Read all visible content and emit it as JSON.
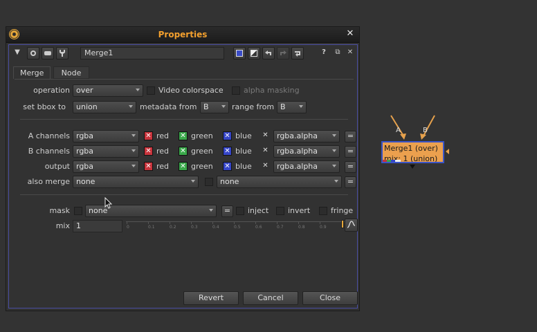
{
  "window": {
    "title": "Properties",
    "close_glyph": "✕",
    "app_icon": "nuke-icon"
  },
  "toolbar": {
    "collapse_glyph": "▼",
    "node_name": "Merge1",
    "help_glyph": "?",
    "float_glyph": "⧉",
    "close_glyph": "✕"
  },
  "tabs": [
    {
      "label": "Merge",
      "active": true
    },
    {
      "label": "Node",
      "active": false
    }
  ],
  "merge": {
    "operation_label": "operation",
    "operation_value": "over",
    "video_colorspace_label": "Video colorspace",
    "alpha_masking_label": "alpha masking",
    "bbox_label": "set bbox to",
    "bbox_value": "union",
    "metadata_label": "metadata from",
    "metadata_value": "B",
    "range_label": "range from",
    "range_value": "B",
    "a_channels_label": "A channels",
    "a_channels_value": "rgba",
    "b_channels_label": "B channels",
    "b_channels_value": "rgba",
    "output_label": "output",
    "output_value": "rgba",
    "red_label": "red",
    "green_label": "green",
    "blue_label": "blue",
    "alpha_value": "rgba.alpha",
    "eq_glyph": "=",
    "also_merge_label": "also merge",
    "also_merge_value1": "none",
    "also_merge_value2": "none",
    "mask_label": "mask",
    "mask_value": "none",
    "inject_label": "inject",
    "invert_label": "invert",
    "fringe_label": "fringe",
    "mix_label": "mix",
    "mix_value": "1",
    "mix_ticks": [
      "0",
      "0.1",
      "0.2",
      "0.3",
      "0.4",
      "0.5",
      "0.6",
      "0.7",
      "0.8",
      "0.9"
    ]
  },
  "footer": {
    "revert_label": "Revert",
    "cancel_label": "Cancel",
    "close_label": "Close"
  },
  "nodegraph": {
    "node_line1": "Merge1 (over)",
    "node_line2": "mix: 1 (union)",
    "input_a": "A",
    "input_b": "B"
  },
  "colors": {
    "accent_orange": "#f3a02e",
    "node_fill": "#eba04e",
    "selection_blue": "#3a54c8",
    "red_channel": "#c8343c",
    "green_channel": "#3aa84a",
    "blue_channel": "#3646c8"
  }
}
